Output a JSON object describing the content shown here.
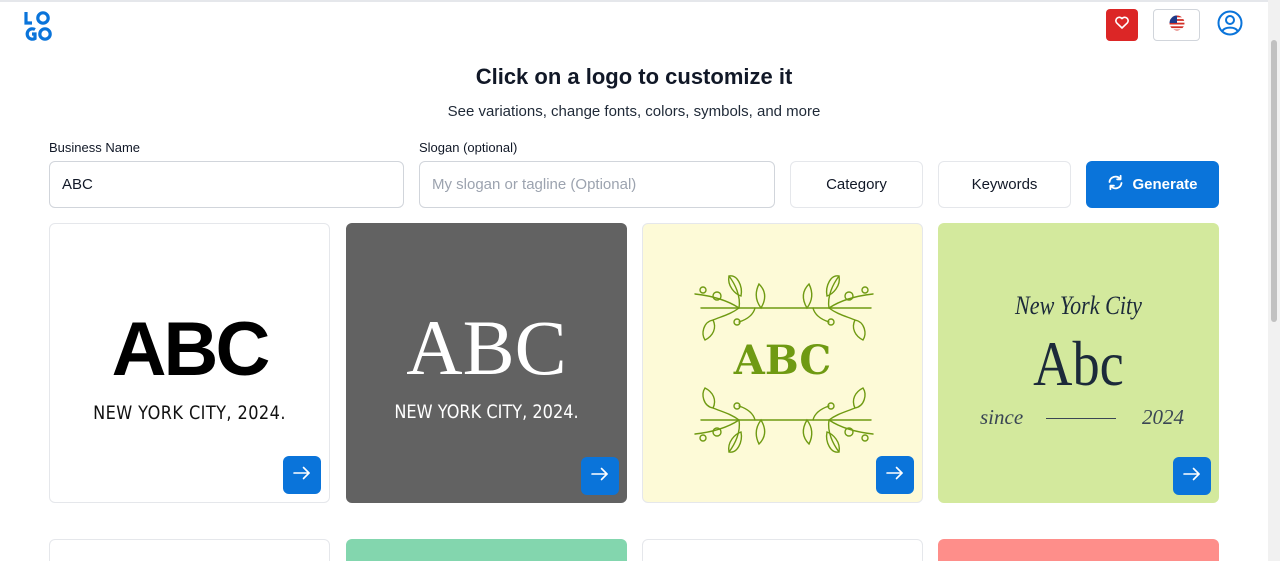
{
  "header": {
    "logo_icon": "logo-mark",
    "favorites_icon": "heart-icon",
    "language_icon": "us-flag-icon",
    "account_icon": "user-icon"
  },
  "hero": {
    "title": "Click on a logo to customize it",
    "subtitle": "See variations, change fonts, colors, symbols, and more"
  },
  "form": {
    "business_label": "Business Name",
    "business_value": "ABC",
    "slogan_label": "Slogan (optional)",
    "slogan_placeholder": "My slogan or tagline (Optional)",
    "category_label": "Category",
    "keywords_label": "Keywords",
    "generate_label": "Generate"
  },
  "cards": [
    {
      "main": "ABC",
      "sub": "NEW YORK CITY, 2024.",
      "bg": "#ffffff"
    },
    {
      "main": "ABC",
      "sub": "NEW YORK CITY, 2024.",
      "bg": "#626262"
    },
    {
      "main": "ABC",
      "bg": "#fdfad7"
    },
    {
      "top": "New York City",
      "main": "Abc",
      "since": "since",
      "year": "2024",
      "bg": "#d3e99d"
    }
  ],
  "next_row_colors": [
    "#ffffff",
    "#83d6ae",
    "#ffffff",
    "#fe8e8a"
  ],
  "colors": {
    "accent": "#0a74da",
    "favorite": "#dc2626"
  }
}
